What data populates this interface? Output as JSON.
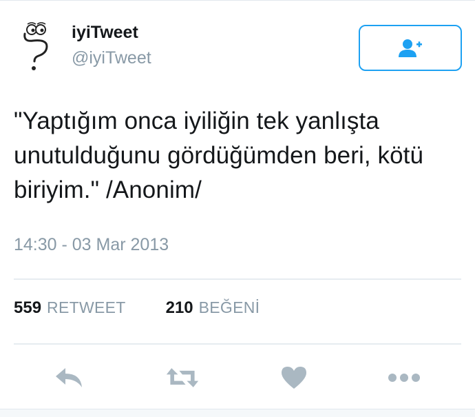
{
  "user": {
    "name": "iyiTweet",
    "handle": "@iyiTweet"
  },
  "follow_button": {
    "icon": "follow-user-icon"
  },
  "tweet": {
    "text_lines": [
      "\"Yaptığım onca iyiliğin tek yanlışta",
      "unutulduğunu gördüğümden beri, kötü",
      "biriyim.\" /Anonim/"
    ],
    "timestamp": "14:30 - 03 Mar 2013"
  },
  "stats": {
    "retweets_count": "559",
    "retweets_label": "RETWEET",
    "likes_count": "210",
    "likes_label": "BEĞENİ"
  },
  "actions": [
    {
      "icon": "reply-icon"
    },
    {
      "icon": "retweet-icon"
    },
    {
      "icon": "like-icon"
    },
    {
      "icon": "more-icon"
    }
  ],
  "colors": {
    "accent": "#1da1f2",
    "text": "#14171a",
    "muted": "#8899a6",
    "icon": "#aab8c2",
    "divider": "#e6ecf0"
  }
}
